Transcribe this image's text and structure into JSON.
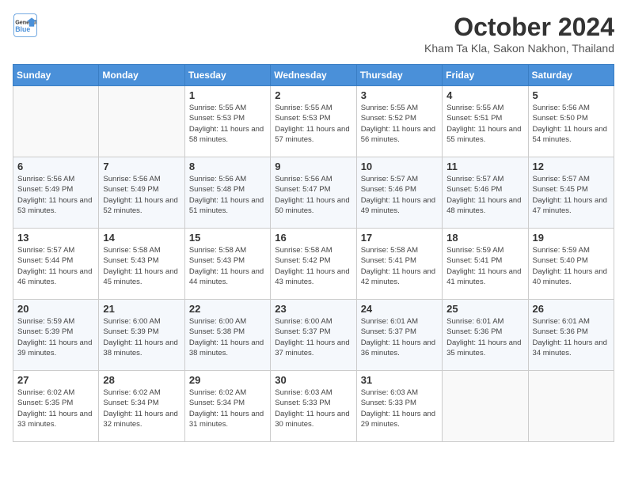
{
  "header": {
    "logo_line1": "General",
    "logo_line2": "Blue",
    "month": "October 2024",
    "location": "Kham Ta Kla, Sakon Nakhon, Thailand"
  },
  "weekdays": [
    "Sunday",
    "Monday",
    "Tuesday",
    "Wednesday",
    "Thursday",
    "Friday",
    "Saturday"
  ],
  "weeks": [
    [
      {
        "day": "",
        "sunrise": "",
        "sunset": "",
        "daylight": ""
      },
      {
        "day": "",
        "sunrise": "",
        "sunset": "",
        "daylight": ""
      },
      {
        "day": "1",
        "sunrise": "Sunrise: 5:55 AM",
        "sunset": "Sunset: 5:53 PM",
        "daylight": "Daylight: 11 hours and 58 minutes."
      },
      {
        "day": "2",
        "sunrise": "Sunrise: 5:55 AM",
        "sunset": "Sunset: 5:53 PM",
        "daylight": "Daylight: 11 hours and 57 minutes."
      },
      {
        "day": "3",
        "sunrise": "Sunrise: 5:55 AM",
        "sunset": "Sunset: 5:52 PM",
        "daylight": "Daylight: 11 hours and 56 minutes."
      },
      {
        "day": "4",
        "sunrise": "Sunrise: 5:55 AM",
        "sunset": "Sunset: 5:51 PM",
        "daylight": "Daylight: 11 hours and 55 minutes."
      },
      {
        "day": "5",
        "sunrise": "Sunrise: 5:56 AM",
        "sunset": "Sunset: 5:50 PM",
        "daylight": "Daylight: 11 hours and 54 minutes."
      }
    ],
    [
      {
        "day": "6",
        "sunrise": "Sunrise: 5:56 AM",
        "sunset": "Sunset: 5:49 PM",
        "daylight": "Daylight: 11 hours and 53 minutes."
      },
      {
        "day": "7",
        "sunrise": "Sunrise: 5:56 AM",
        "sunset": "Sunset: 5:49 PM",
        "daylight": "Daylight: 11 hours and 52 minutes."
      },
      {
        "day": "8",
        "sunrise": "Sunrise: 5:56 AM",
        "sunset": "Sunset: 5:48 PM",
        "daylight": "Daylight: 11 hours and 51 minutes."
      },
      {
        "day": "9",
        "sunrise": "Sunrise: 5:56 AM",
        "sunset": "Sunset: 5:47 PM",
        "daylight": "Daylight: 11 hours and 50 minutes."
      },
      {
        "day": "10",
        "sunrise": "Sunrise: 5:57 AM",
        "sunset": "Sunset: 5:46 PM",
        "daylight": "Daylight: 11 hours and 49 minutes."
      },
      {
        "day": "11",
        "sunrise": "Sunrise: 5:57 AM",
        "sunset": "Sunset: 5:46 PM",
        "daylight": "Daylight: 11 hours and 48 minutes."
      },
      {
        "day": "12",
        "sunrise": "Sunrise: 5:57 AM",
        "sunset": "Sunset: 5:45 PM",
        "daylight": "Daylight: 11 hours and 47 minutes."
      }
    ],
    [
      {
        "day": "13",
        "sunrise": "Sunrise: 5:57 AM",
        "sunset": "Sunset: 5:44 PM",
        "daylight": "Daylight: 11 hours and 46 minutes."
      },
      {
        "day": "14",
        "sunrise": "Sunrise: 5:58 AM",
        "sunset": "Sunset: 5:43 PM",
        "daylight": "Daylight: 11 hours and 45 minutes."
      },
      {
        "day": "15",
        "sunrise": "Sunrise: 5:58 AM",
        "sunset": "Sunset: 5:43 PM",
        "daylight": "Daylight: 11 hours and 44 minutes."
      },
      {
        "day": "16",
        "sunrise": "Sunrise: 5:58 AM",
        "sunset": "Sunset: 5:42 PM",
        "daylight": "Daylight: 11 hours and 43 minutes."
      },
      {
        "day": "17",
        "sunrise": "Sunrise: 5:58 AM",
        "sunset": "Sunset: 5:41 PM",
        "daylight": "Daylight: 11 hours and 42 minutes."
      },
      {
        "day": "18",
        "sunrise": "Sunrise: 5:59 AM",
        "sunset": "Sunset: 5:41 PM",
        "daylight": "Daylight: 11 hours and 41 minutes."
      },
      {
        "day": "19",
        "sunrise": "Sunrise: 5:59 AM",
        "sunset": "Sunset: 5:40 PM",
        "daylight": "Daylight: 11 hours and 40 minutes."
      }
    ],
    [
      {
        "day": "20",
        "sunrise": "Sunrise: 5:59 AM",
        "sunset": "Sunset: 5:39 PM",
        "daylight": "Daylight: 11 hours and 39 minutes."
      },
      {
        "day": "21",
        "sunrise": "Sunrise: 6:00 AM",
        "sunset": "Sunset: 5:39 PM",
        "daylight": "Daylight: 11 hours and 38 minutes."
      },
      {
        "day": "22",
        "sunrise": "Sunrise: 6:00 AM",
        "sunset": "Sunset: 5:38 PM",
        "daylight": "Daylight: 11 hours and 38 minutes."
      },
      {
        "day": "23",
        "sunrise": "Sunrise: 6:00 AM",
        "sunset": "Sunset: 5:37 PM",
        "daylight": "Daylight: 11 hours and 37 minutes."
      },
      {
        "day": "24",
        "sunrise": "Sunrise: 6:01 AM",
        "sunset": "Sunset: 5:37 PM",
        "daylight": "Daylight: 11 hours and 36 minutes."
      },
      {
        "day": "25",
        "sunrise": "Sunrise: 6:01 AM",
        "sunset": "Sunset: 5:36 PM",
        "daylight": "Daylight: 11 hours and 35 minutes."
      },
      {
        "day": "26",
        "sunrise": "Sunrise: 6:01 AM",
        "sunset": "Sunset: 5:36 PM",
        "daylight": "Daylight: 11 hours and 34 minutes."
      }
    ],
    [
      {
        "day": "27",
        "sunrise": "Sunrise: 6:02 AM",
        "sunset": "Sunset: 5:35 PM",
        "daylight": "Daylight: 11 hours and 33 minutes."
      },
      {
        "day": "28",
        "sunrise": "Sunrise: 6:02 AM",
        "sunset": "Sunset: 5:34 PM",
        "daylight": "Daylight: 11 hours and 32 minutes."
      },
      {
        "day": "29",
        "sunrise": "Sunrise: 6:02 AM",
        "sunset": "Sunset: 5:34 PM",
        "daylight": "Daylight: 11 hours and 31 minutes."
      },
      {
        "day": "30",
        "sunrise": "Sunrise: 6:03 AM",
        "sunset": "Sunset: 5:33 PM",
        "daylight": "Daylight: 11 hours and 30 minutes."
      },
      {
        "day": "31",
        "sunrise": "Sunrise: 6:03 AM",
        "sunset": "Sunset: 5:33 PM",
        "daylight": "Daylight: 11 hours and 29 minutes."
      },
      {
        "day": "",
        "sunrise": "",
        "sunset": "",
        "daylight": ""
      },
      {
        "day": "",
        "sunrise": "",
        "sunset": "",
        "daylight": ""
      }
    ]
  ]
}
